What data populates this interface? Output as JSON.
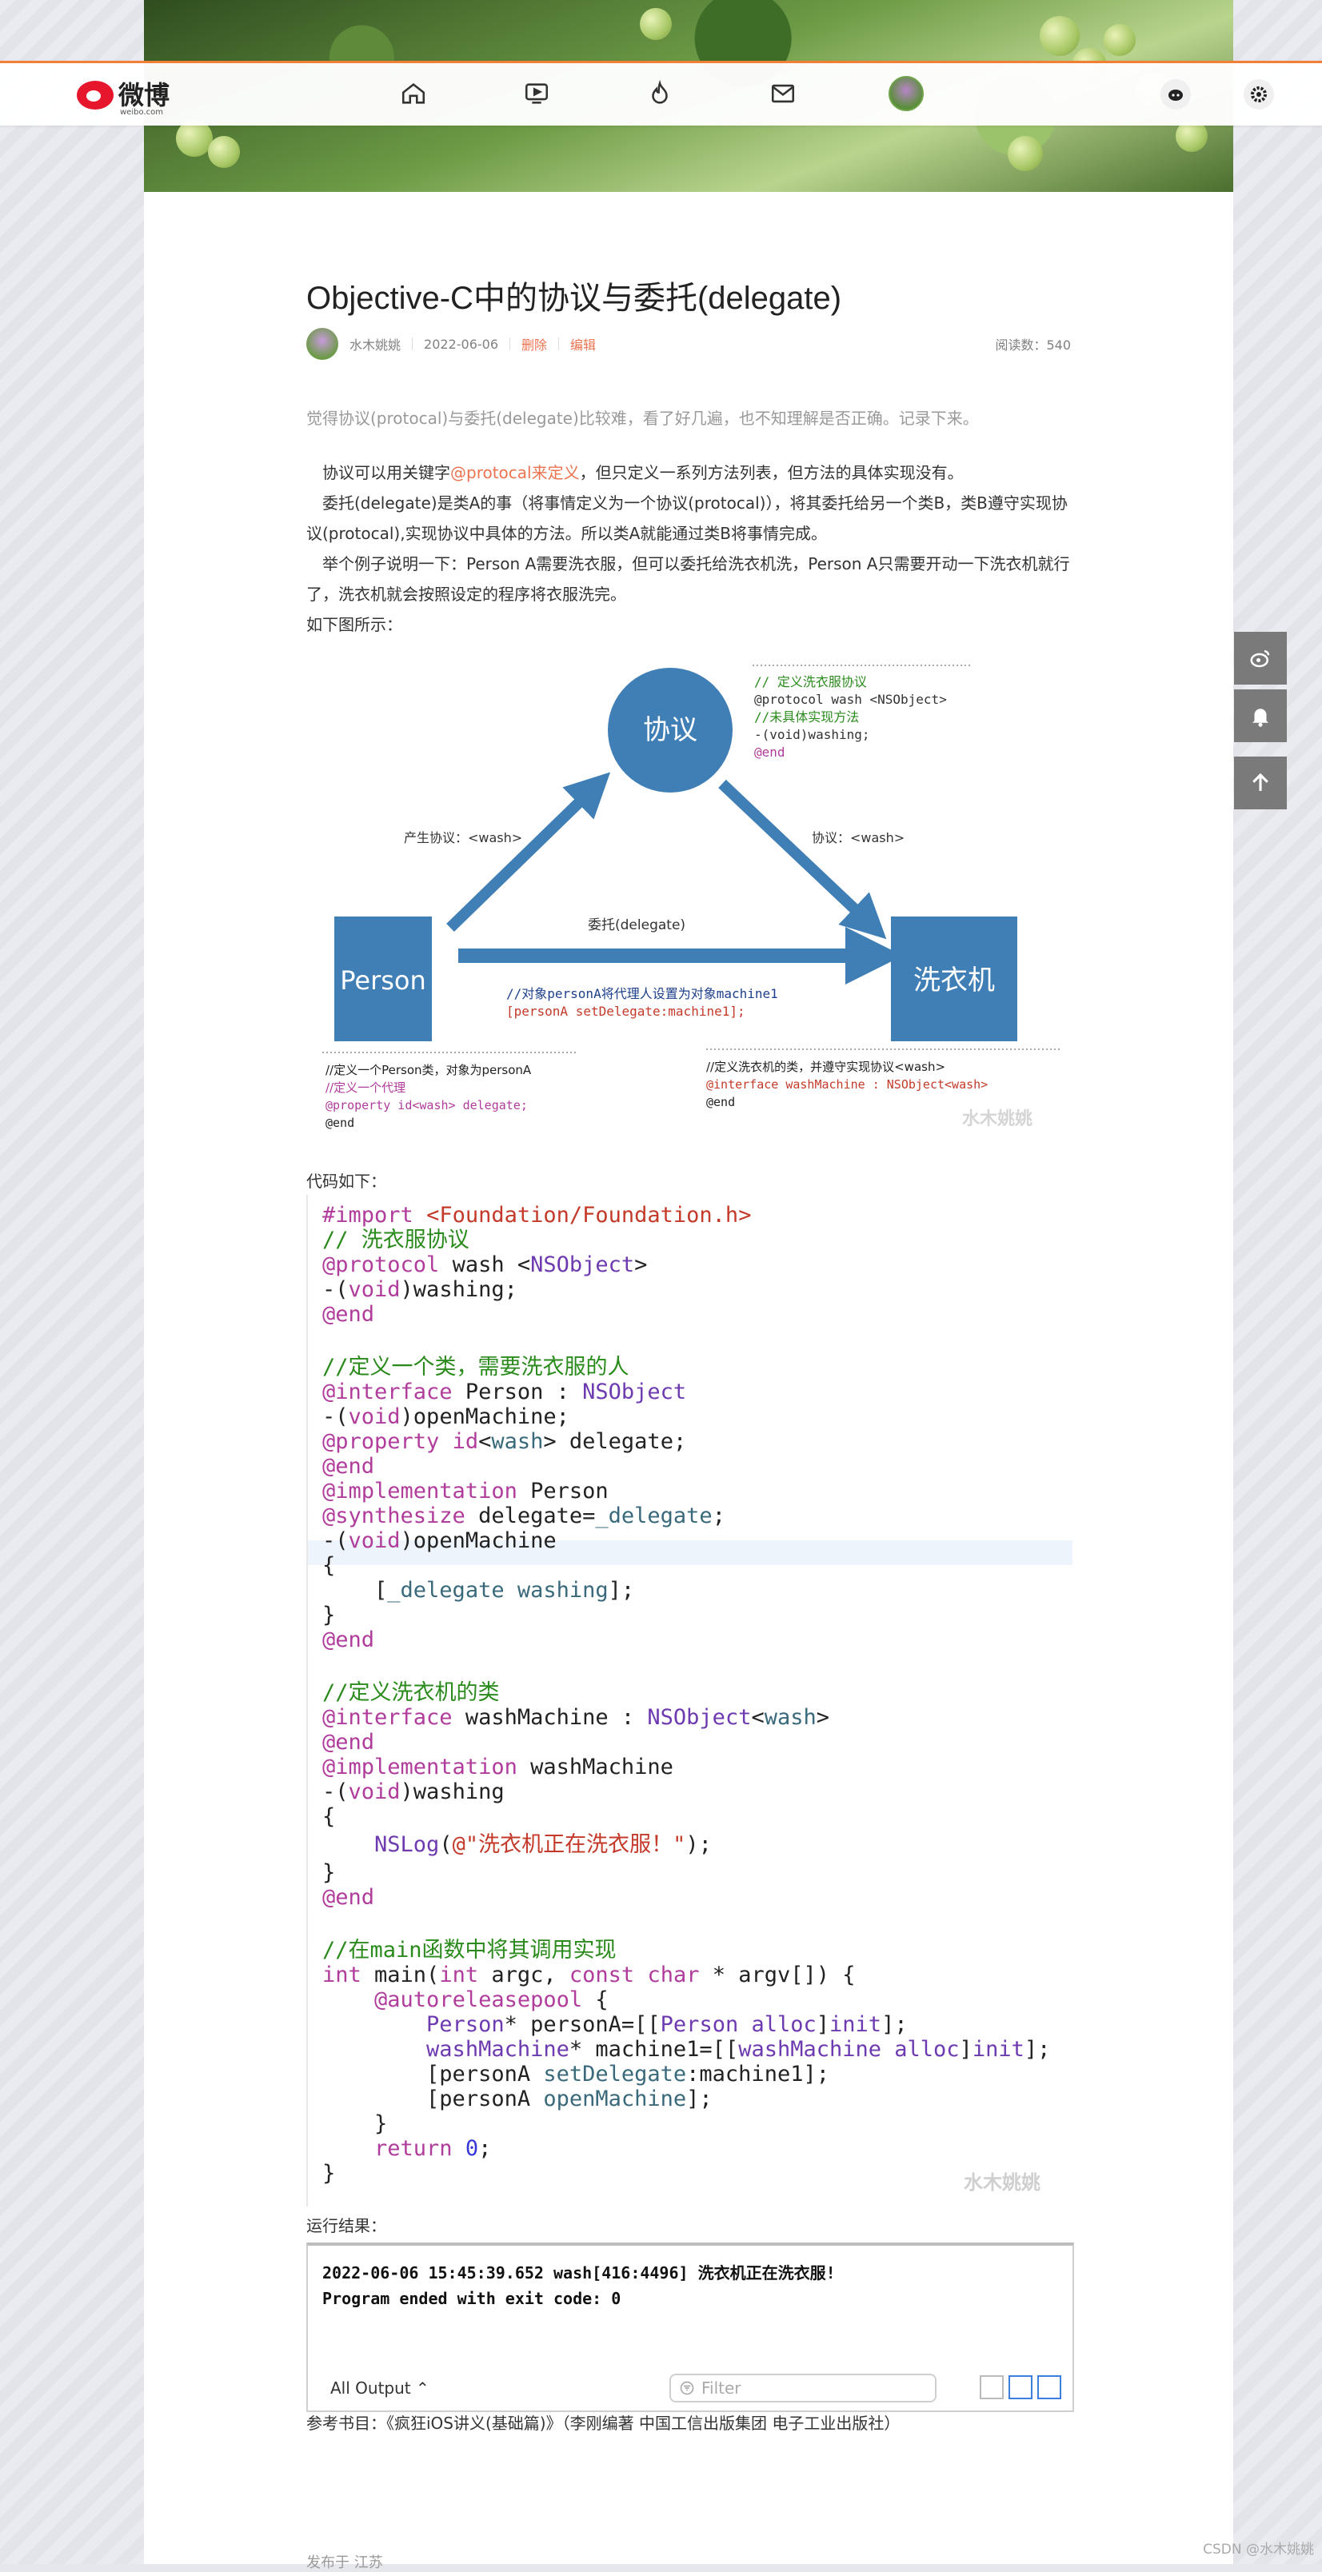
{
  "topbar": {
    "logo_text": "微博",
    "logo_sub": "weibo.com",
    "nav": [
      "home-icon",
      "video-icon",
      "hot-icon",
      "mail-icon",
      "profile-avatar"
    ]
  },
  "article": {
    "title": "Objective-C中的协议与委托(delegate)",
    "author": "水木姚姚",
    "date": "2022-06-06",
    "delete_label": "删除",
    "edit_label": "编辑",
    "reads": "阅读数：540",
    "lead": "觉得协议(protocal)与委托(delegate)比较难，看了好几遍，也不知理解是否正确。记录下来。",
    "p1_pre": "　协议可以用关键字",
    "p1_hl": "@protocal来定义",
    "p1_post": "，但只定义一系列方法列表，但方法的具体实现没有。",
    "p2": "　委托(delegate)是类A的事（将事情定义为一个协议(protocal)），将其委托给另一个类B，类B遵守实现协议(protocal),实现协议中具体的方法。所以类A就能通过类B将事情完成。",
    "p3": "　举个例子说明一下：Person A需要洗衣服，但可以委托给洗衣机洗，Person A只需要开动一下洗衣机就行了，洗衣机就会按照设定的程序将衣服洗完。",
    "p4": " 如下图所示：",
    "code_intro": "代码如下：",
    "run_intro": "运行结果：",
    "reference": "参考书目：《疯狂iOS讲义(基础篇)》（李刚编著 中国工信出版集团 电子工业出版社）",
    "published": "发布于 江苏"
  },
  "diagram": {
    "protocol_node": "协议",
    "person_node": "Person",
    "washer_node": "洗衣机",
    "edge_left": "产生协议：<wash>",
    "edge_right": "协议：<wash>",
    "edge_bottom": "委托(delegate)",
    "note_top_1": "// 定义洗衣服协议",
    "note_top_2": "@protocol wash <NSObject>",
    "note_top_3": "//未具体实现方法",
    "note_top_4": "-(void)washing;",
    "note_top_5": "@end",
    "note_mid_1": "//对象personA将代理人设置为对象machine1",
    "note_mid_2": "[personA setDelegate:machine1];",
    "note_left_1": "//定义一个Person类，对象为personA",
    "note_left_2": "//定义一个代理",
    "note_left_3": "@property id<wash> delegate;",
    "note_left_4": "@end",
    "note_right_1": "//定义洗衣机的类，并遵守实现协议<wash>",
    "note_right_2": "@interface washMachine : NSObject<wash>",
    "note_right_3": "@end",
    "watermark": "水木姚姚"
  },
  "output": {
    "line1": "2022-06-06 15:45:39.652 wash[416:4496] 洗衣机正在洗衣服!",
    "line2": "Program ended with exit code: 0",
    "selector": "All Output ⌃",
    "filter_placeholder": "Filter"
  },
  "watermark_code": "水木姚姚",
  "csdn": "CSDN @水木姚姚",
  "colors": {
    "accent": "#eb7350",
    "node_blue": "#3f7fb6",
    "topbar_border": "#f27f36"
  }
}
